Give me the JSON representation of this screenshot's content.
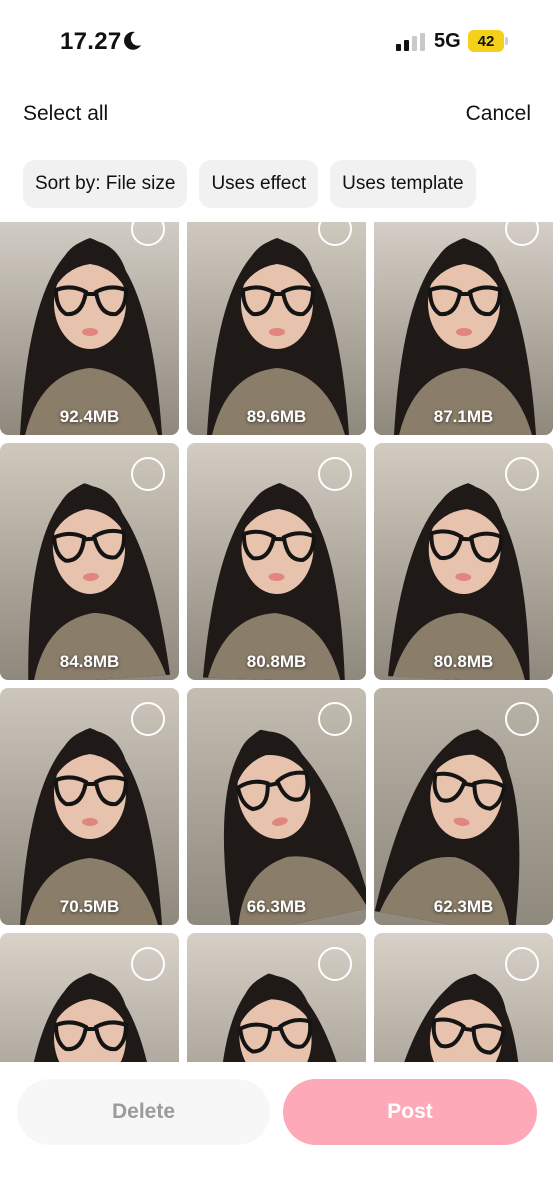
{
  "status_bar": {
    "time": "17.27",
    "network": "5G",
    "battery": "42",
    "battery_color": "#f5d019"
  },
  "top_bar": {
    "select_all": "Select all",
    "cancel": "Cancel"
  },
  "filters": [
    {
      "label": "Sort by: File size"
    },
    {
      "label": "Uses effect"
    },
    {
      "label": "Uses template"
    }
  ],
  "videos": [
    {
      "size": "92.4MB"
    },
    {
      "size": "89.6MB"
    },
    {
      "size": "87.1MB"
    },
    {
      "size": "84.8MB"
    },
    {
      "size": "80.8MB"
    },
    {
      "size": "80.8MB"
    },
    {
      "size": "70.5MB"
    },
    {
      "size": "66.3MB"
    },
    {
      "size": "62.3MB"
    },
    {
      "size": ""
    },
    {
      "size": ""
    },
    {
      "size": ""
    }
  ],
  "actions": {
    "delete": "Delete",
    "post": "Post",
    "post_color": "#fda9b8"
  }
}
